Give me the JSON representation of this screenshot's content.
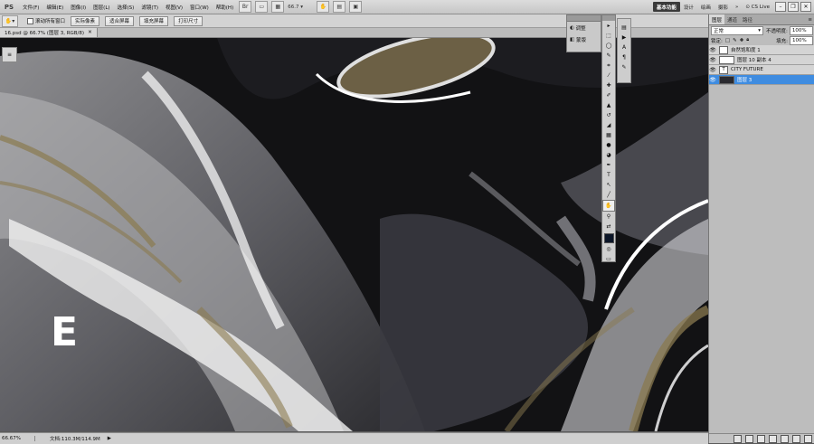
{
  "app": {
    "logo": "PS"
  },
  "menu": [
    "文件(F)",
    "编辑(E)",
    "图像(I)",
    "图层(L)",
    "选择(S)",
    "滤镜(T)",
    "视图(V)",
    "窗口(W)",
    "帮助(H)"
  ],
  "zoom_menu": "66.7",
  "workspaces": [
    {
      "label": "基本功能",
      "active": true
    },
    {
      "label": "设计",
      "active": false
    },
    {
      "label": "绘画",
      "active": false
    },
    {
      "label": "摄影",
      "active": false
    }
  ],
  "cs_live": "CS Live",
  "options": {
    "scroll_all": "滚动所有窗口",
    "buttons": [
      "实际像素",
      "适合屏幕",
      "填充屏幕",
      "打印尺寸"
    ]
  },
  "document": {
    "tab_title": "16.psd @ 66.7% (图层 3, RGB/8)",
    "canvas_text": "E"
  },
  "status": {
    "zoom": "66.67%",
    "doc_info": "文档:110.3M/114.9M"
  },
  "adjust_panel": [
    {
      "label": "调整"
    },
    {
      "label": "蒙版"
    }
  ],
  "layers_panel": {
    "tabs": [
      {
        "label": "图层",
        "active": true
      },
      {
        "label": "通道",
        "active": false
      },
      {
        "label": "路径",
        "active": false
      }
    ],
    "blend_mode": "正常",
    "opacity_label": "不透明度:",
    "opacity_value": "100%",
    "lock_label": "锁定:",
    "fill_label": "填充:",
    "fill_value": "100%",
    "layers": [
      {
        "name": "自然饱和度 1",
        "selected": false
      },
      {
        "name": "图层 10 副本 4",
        "selected": false
      },
      {
        "name": "CITY FUTURE",
        "selected": false
      },
      {
        "name": "图层 3",
        "selected": true
      }
    ]
  },
  "colors": {
    "selected_layer": "#3f8ce0",
    "accent_gold": "#8a7a4f"
  }
}
